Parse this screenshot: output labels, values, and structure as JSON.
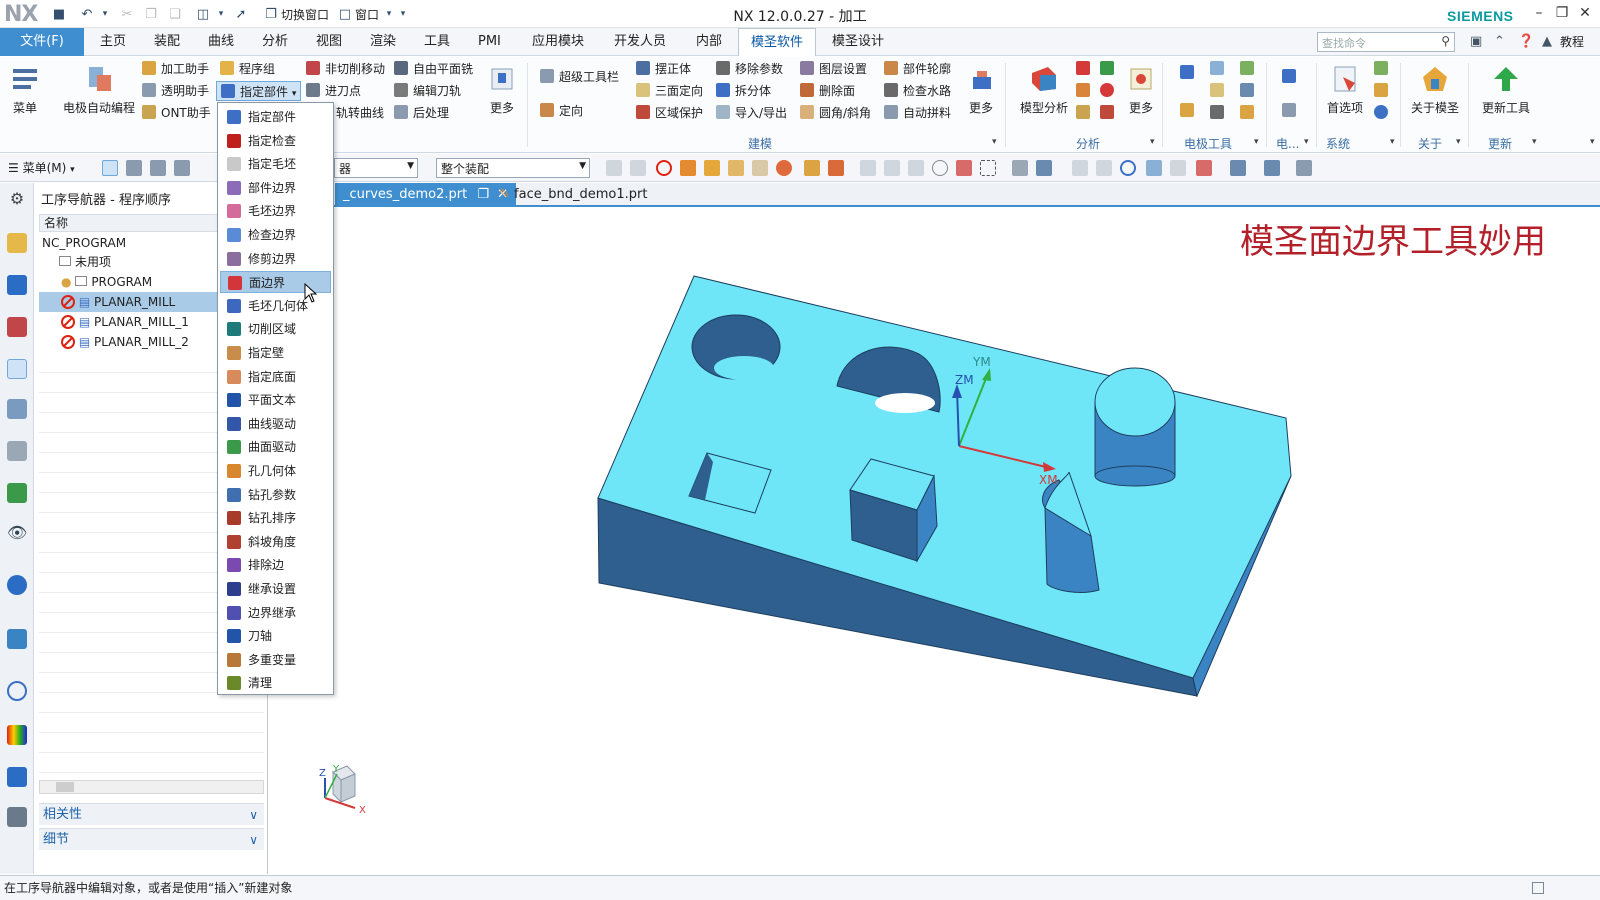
{
  "app": {
    "logo": "NX",
    "window_title": "NX 12.0.0.27 - 加工",
    "brand": "SIEMENS",
    "quick_access": {
      "switch_window": "切换窗口",
      "window": "窗口"
    }
  },
  "menubar": {
    "file": "文件(F)",
    "items": [
      "主页",
      "装配",
      "曲线",
      "分析",
      "视图",
      "渲染",
      "工具",
      "PMI",
      "应用模块",
      "开发人员",
      "内部",
      "模圣软件",
      "模圣设计"
    ],
    "active_index": 11,
    "search_placeholder": "查找命令",
    "tutorial": "教程"
  },
  "ribbon": {
    "menu": "菜单",
    "electrode_auto": "电极自动编程",
    "col1": [
      "加工助手",
      "透明助手",
      "ONT助手"
    ],
    "col2": [
      "程序组",
      "指定部件",
      "轨转曲线"
    ],
    "col3": [
      "非切削移动",
      "进刀点",
      "轨转曲线"
    ],
    "col4": [
      "自由平面铣",
      "编辑刀轨",
      "后处理"
    ],
    "more": "更多",
    "super_toolbar": "超级工具栏",
    "orient": "定向",
    "col5": [
      "摆正体",
      "三面定向",
      "区域保护"
    ],
    "col6": [
      "移除参数",
      "拆分体",
      "导入/导出"
    ],
    "col7": [
      "图层设置",
      "删除面",
      "圆角/斜角"
    ],
    "col8": [
      "部件轮廓",
      "检查水路",
      "自动拼料"
    ],
    "model_analysis": "模型分析",
    "prefs": "首选项",
    "about": "关于模圣",
    "update_tool": "更新工具",
    "groups": [
      "建模",
      "分析",
      "电极工具",
      "电...",
      "系统",
      "关于",
      "更新"
    ]
  },
  "toolbar": {
    "menu": "菜单(M)",
    "filter": "器",
    "assembly": "整个装配"
  },
  "navigator": {
    "title": "工序导航器 - 程序顺序",
    "column": "名称",
    "root": "NC_PROGRAM",
    "unused": "未用项",
    "program": "PROGRAM",
    "ops": [
      "PLANAR_MILL",
      "PLANAR_MILL_1",
      "PLANAR_MILL_2"
    ],
    "sections": [
      "相关性",
      "细节"
    ]
  },
  "dropdown": {
    "items": [
      "指定部件",
      "指定检查",
      "指定毛坯",
      "部件边界",
      "毛坯边界",
      "检查边界",
      "修剪边界",
      "面边界",
      "毛坯几何体",
      "切削区域",
      "指定壁",
      "指定底面",
      "平面文本",
      "曲线驱动",
      "曲面驱动",
      "孔几何体",
      "钻孔参数",
      "钻孔排序",
      "斜坡角度",
      "排除边",
      "继承设置",
      "边界继承",
      "刀轴",
      "多重变量",
      "清理"
    ],
    "highlighted_index": 7,
    "colors": [
      "#3d6fc4",
      "#c0201b",
      "#c9c9c9",
      "#8c6bb8",
      "#d46b9b",
      "#5a8bd6",
      "#8a6e9e",
      "#d4353a",
      "#3e68c0",
      "#1f7a7a",
      "#c98c4a",
      "#d98a5a",
      "#2255aa",
      "#3355aa",
      "#3b9a4a",
      "#d8872e",
      "#3f6fb0",
      "#a83a2a",
      "#b04030",
      "#7a4ab0",
      "#2c3e8c",
      "#5050b0",
      "#2255aa",
      "#b8783a",
      "#6a8a2a"
    ]
  },
  "tabs": [
    {
      "label": "_curves_demo2.prt",
      "active": true
    },
    {
      "label": "face_bnd_demo1.prt",
      "active": false
    }
  ],
  "graphics": {
    "overlay_title": "模圣面边界工具妙用",
    "axis_labels": {
      "xm": "XM",
      "ym": "YM",
      "zm": "ZM"
    },
    "triad_labels": {
      "x": "X",
      "y": "Y",
      "z": "Z"
    },
    "colors": {
      "top": "#6fe6f7",
      "side": "#3b84c4",
      "front": "#2e5f8f"
    }
  },
  "status": {
    "message": "在工序导航器中编辑对象，或者是使用“插入”新建对象"
  }
}
